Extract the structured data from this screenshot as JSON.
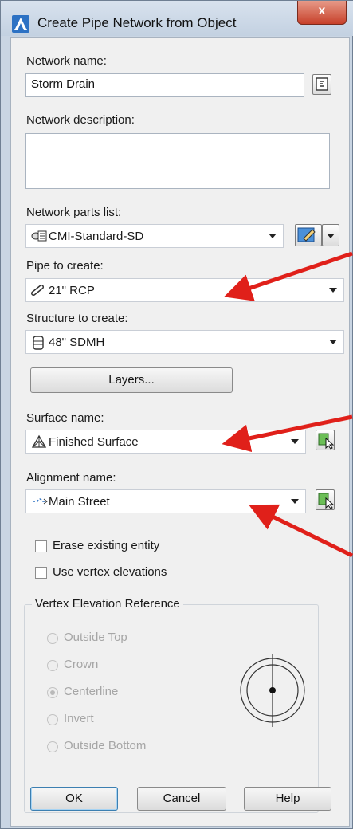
{
  "window": {
    "title": "Create Pipe Network from Object",
    "close_glyph": "x",
    "icon": "autocad-a-icon"
  },
  "network_name": {
    "label": "Network name:",
    "value": "Storm Drain"
  },
  "network_description": {
    "label": "Network description:",
    "value": ""
  },
  "parts_list": {
    "label": "Network parts list:",
    "value": "CMI-Standard-SD",
    "icon": "parts-list-icon"
  },
  "pipe": {
    "label": "Pipe to create:",
    "value": "21\" RCP",
    "icon": "pipe-icon"
  },
  "structure": {
    "label": "Structure to create:",
    "value": "48\" SDMH",
    "icon": "structure-icon"
  },
  "layers_button": "Layers...",
  "surface": {
    "label": "Surface name:",
    "value": "Finished Surface",
    "icon": "surface-icon"
  },
  "alignment": {
    "label": "Alignment name:",
    "value": "Main Street",
    "icon": "alignment-icon"
  },
  "options": {
    "erase_existing": {
      "label": "Erase existing entity",
      "checked": false
    },
    "use_vertex_elevations": {
      "label": "Use vertex elevations",
      "checked": false
    }
  },
  "vertex_reference": {
    "title": "Vertex Elevation Reference",
    "options": [
      {
        "label": "Outside Top",
        "selected": false
      },
      {
        "label": "Crown",
        "selected": false
      },
      {
        "label": "Centerline",
        "selected": true
      },
      {
        "label": "Invert",
        "selected": false
      },
      {
        "label": "Outside Bottom",
        "selected": false
      }
    ]
  },
  "buttons": {
    "ok": "OK",
    "cancel": "Cancel",
    "help": "Help"
  },
  "colors": {
    "title_bar": "#c9d5e3",
    "close_button": "#c7402a",
    "annotation_arrow": "#e0201a",
    "ok_focus": "#3c7fb1"
  }
}
